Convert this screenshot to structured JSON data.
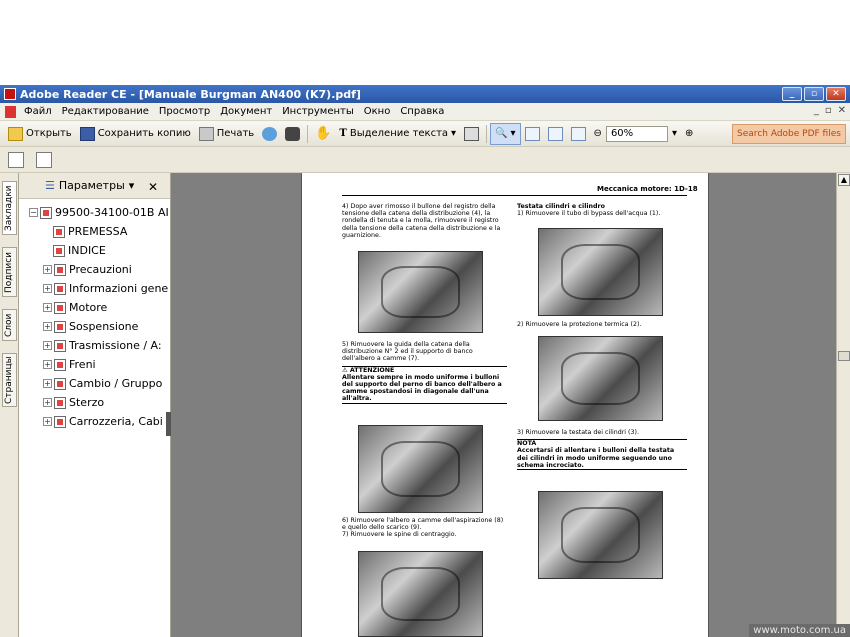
{
  "window": {
    "title": "Adobe Reader CE - [Manuale Burgman AN400 (K7).pdf]"
  },
  "menu": {
    "items": [
      "Файл",
      "Редактирование",
      "Просмотр",
      "Документ",
      "Инструменты",
      "Окно",
      "Справка"
    ]
  },
  "toolbar": {
    "open_label": "Открыть",
    "save_label": "Сохранить копию",
    "print_label": "Печать",
    "select_text_label": "Выделение текста",
    "zoom_value": "60%",
    "search_adobe_label": "Search Adobe PDF files"
  },
  "left_tabs": [
    "Закладки",
    "Подписи",
    "Слои",
    "Страницы"
  ],
  "nav_panel": {
    "header_label": "Параметры",
    "root": "99500-34100-01B AI",
    "items": [
      {
        "label": "PREMESSA"
      },
      {
        "label": "INDICE"
      },
      {
        "label": "Precauzioni"
      },
      {
        "label": "Informazioni gene"
      },
      {
        "label": "Motore"
      },
      {
        "label": "Sospensione"
      },
      {
        "label": "Trasmissione / A:"
      },
      {
        "label": "Freni"
      },
      {
        "label": "Cambio / Gruppo"
      },
      {
        "label": "Sterzo"
      },
      {
        "label": "Carrozzeria, Cabi"
      }
    ]
  },
  "document": {
    "header": "Meccanica motore:   1D-18",
    "left_col": {
      "step4": "4) Dopo aver rimosso il bullone del registro della tensione della catena della distribuzione (4), la rondella di tenuta e la molla, rimuovere il registro della tensione della catena della distribuzione e la guarnizione.",
      "step5": "5) Rimuovere la guida della catena della distribuzione N° 2 ed il supporto di banco dell'albero a camme (7).",
      "warning_title": "⚠ ATTENZIONE",
      "warning_text": "Allentare sempre in modo uniforme i bulloni del supporto del perno di banco dell'albero a camme spostandosi in diagonale dall'una all'altra.",
      "step6": "6) Rimuovere l'albero a camme dell'aspirazione (8) e quello dello scarico (9).",
      "step7": "7) Rimuovere le spine di centraggio."
    },
    "right_col": {
      "section_title": "Testata cilindri e cilindro",
      "step1": "1) Rimuovere il tubo di bypass dell'acqua (1).",
      "step2": "2) Rimuovere la protezione termica (2).",
      "step3": "3) Rimuovere la testata dei cilindri (3).",
      "note_title": "NOTA",
      "note_text": "Accertarsi di allentare i bulloni della testata dei cilindri in modo uniforme seguendo uno schema incrociato."
    }
  },
  "watermark": "www.moto.com.ua"
}
